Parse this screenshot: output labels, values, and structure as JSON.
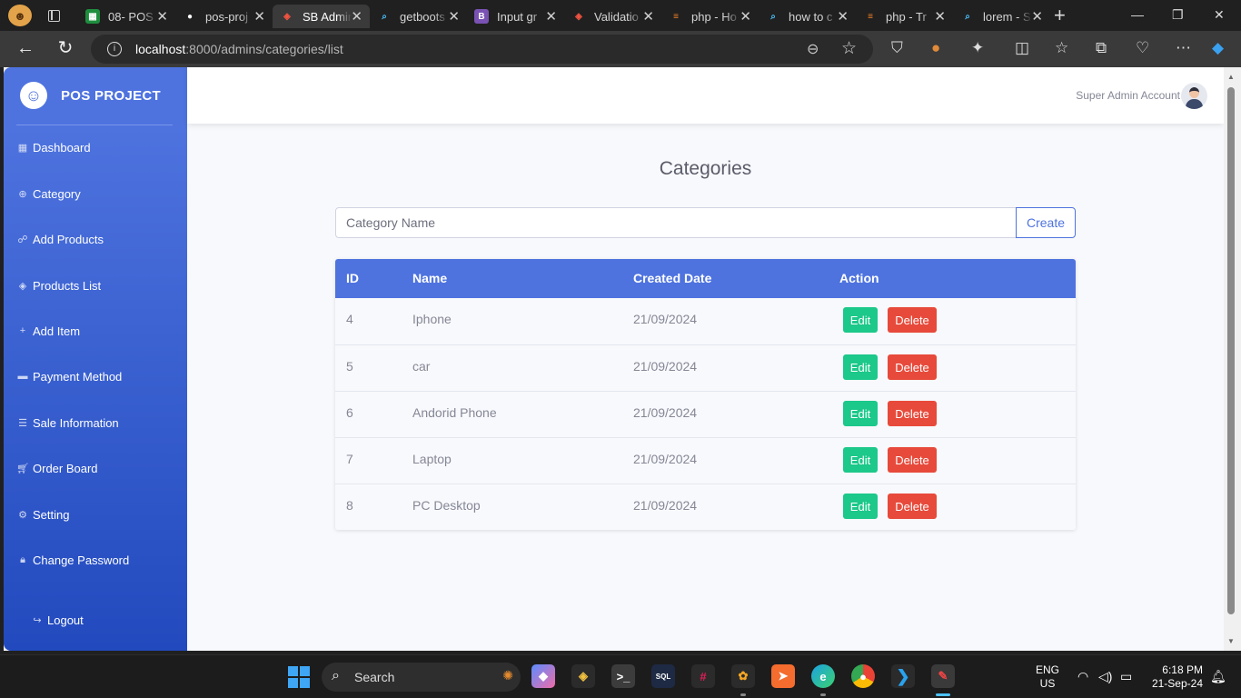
{
  "browser": {
    "tabs": [
      {
        "title": "08- POS",
        "favicon": "green-sheets-icon",
        "color": "#1e8e3e"
      },
      {
        "title": "pos-proj",
        "favicon": "github-icon",
        "color": "#ffffff"
      },
      {
        "title": "SB Admin",
        "favicon": "laravel-icon",
        "color": "#f05340",
        "active": true
      },
      {
        "title": "getboots",
        "favicon": "search-icon",
        "color": "#4cc2ff"
      },
      {
        "title": "Input gr",
        "favicon": "bootstrap-icon",
        "color": "#7952b3"
      },
      {
        "title": "Validatio",
        "favicon": "laravel-icon",
        "color": "#f05340"
      },
      {
        "title": "php - Ho",
        "favicon": "stackoverflow-icon",
        "color": "#f48024"
      },
      {
        "title": "how to c",
        "favicon": "search-icon",
        "color": "#4cc2ff"
      },
      {
        "title": "php - Tr",
        "favicon": "stackoverflow-icon",
        "color": "#f48024"
      },
      {
        "title": "lorem - S",
        "favicon": "search-icon",
        "color": "#4cc2ff"
      }
    ],
    "url_host": "localhost",
    "url_path": ":8000/admins/categories/list"
  },
  "sidebar": {
    "brand": "POS PROJECT",
    "items": [
      {
        "label": "Dashboard",
        "icon": "table-icon"
      },
      {
        "label": "Category",
        "icon": "plus-circle-icon"
      },
      {
        "label": "Add Products",
        "icon": "sitemap-icon"
      },
      {
        "label": "Products List",
        "icon": "layers-icon"
      },
      {
        "label": "Add Item",
        "icon": "plus-icon"
      },
      {
        "label": "Payment Method",
        "icon": "credit-card-icon"
      },
      {
        "label": "Sale Information",
        "icon": "list-icon"
      },
      {
        "label": "Order Board",
        "icon": "cart-icon"
      },
      {
        "label": "Setting",
        "icon": "gear-icon"
      },
      {
        "label": "Change Password",
        "icon": "lock-icon"
      }
    ],
    "logout": "Logout"
  },
  "topbar": {
    "user_name": "Super Admin Account"
  },
  "main": {
    "title": "Categories",
    "input_placeholder": "Category Name",
    "create_label": "Create",
    "columns": [
      "ID",
      "Name",
      "Created Date",
      "Action"
    ],
    "rows": [
      {
        "id": "4",
        "name": "Iphone",
        "date": "21/09/2024"
      },
      {
        "id": "5",
        "name": "car",
        "date": "21/09/2024"
      },
      {
        "id": "6",
        "name": "Andorid Phone",
        "date": "21/09/2024"
      },
      {
        "id": "7",
        "name": "Laptop",
        "date": "21/09/2024"
      },
      {
        "id": "8",
        "name": "PC Desktop",
        "date": "21/09/2024"
      }
    ],
    "edit_label": "Edit",
    "delete_label": "Delete"
  },
  "taskbar": {
    "search_label": "Search",
    "lang_top": "ENG",
    "lang_bottom": "US",
    "time": "6:18 PM",
    "date": "21-Sep-24"
  }
}
